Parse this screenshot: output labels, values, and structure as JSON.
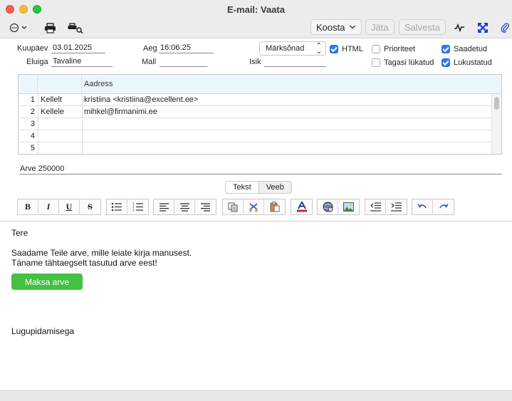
{
  "window": {
    "title": "E-mail: Vaata"
  },
  "toolbar": {
    "compose_label": "Koosta",
    "skip_label": "Jäta",
    "save_label": "Salvesta",
    "icons": [
      "more-icon",
      "print-icon",
      "print-preview-icon",
      "activity-icon",
      "expand-icon",
      "attachment-icon"
    ]
  },
  "form": {
    "date_label": "Kuupäev",
    "date_value": "03.01.2025",
    "time_label": "Aeg",
    "time_value": "16:06:25",
    "keywords_select": "Märksõnad",
    "lifespan_label": "Eluiga",
    "lifespan_value": "Tavaline",
    "template_label": "Mall",
    "template_value": "",
    "person_label": "Isik",
    "person_value": "",
    "html_label": "HTML",
    "html_checked": true,
    "priority_label": "Prioriteet",
    "priority_checked": false,
    "return_receipt_label": "Tagasi lükatud",
    "return_receipt_checked": false,
    "sent_label": "Saadetud",
    "sent_checked": true,
    "read_label": "Lukustatud",
    "read_checked": true
  },
  "recipients": {
    "header_address": "Aadress",
    "rows": [
      {
        "num": "1",
        "type": "Kellelt",
        "address": "kristiina <kristiina@excellent.ee>"
      },
      {
        "num": "2",
        "type": "Kellele",
        "address": "mihkel@firmanimi.ee"
      },
      {
        "num": "3",
        "type": "",
        "address": ""
      },
      {
        "num": "4",
        "type": "",
        "address": ""
      },
      {
        "num": "5",
        "type": "",
        "address": ""
      }
    ]
  },
  "subject": "Arve 250000",
  "view_tabs": {
    "text": "Tekst",
    "web": "Veeb"
  },
  "editor_toolbar": {
    "bold": "B",
    "italic": "I",
    "underline": "U",
    "strike": "S"
  },
  "body": {
    "greeting": "Tere",
    "line1": "Saadame Teile arve, mille leiate kirja manusest.",
    "line2": "Täname tähtaegselt tasutud arve eest!",
    "pay_button": "Maksa arve",
    "closing": "Lugupidamisega"
  },
  "colors": {
    "pay_button": "#44c043",
    "checkbox_checked": "#2e7cf6",
    "grid_header": "#eaf6fb"
  }
}
